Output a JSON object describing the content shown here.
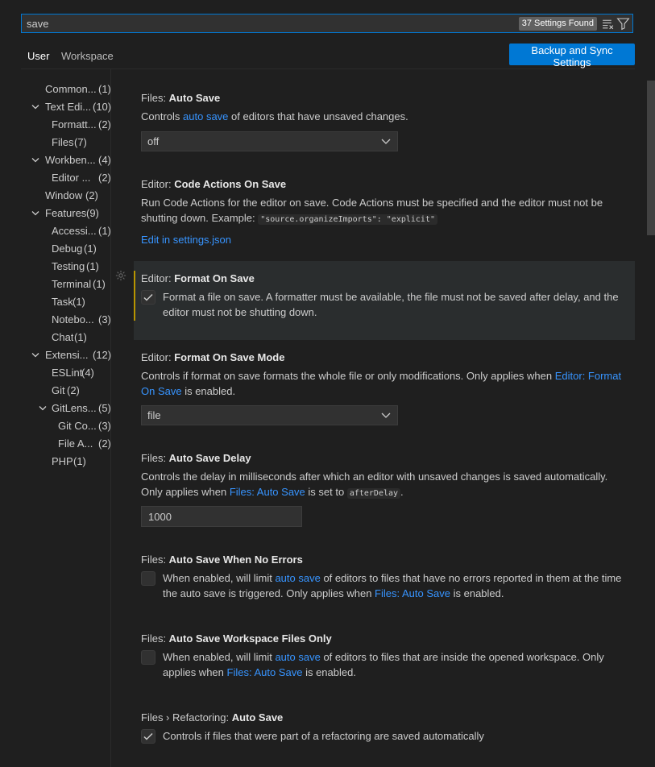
{
  "search": {
    "value": "save",
    "found": "37 Settings Found"
  },
  "tabs": {
    "user": "User",
    "workspace": "Workspace"
  },
  "sync_button": "Backup and Sync Settings",
  "toc": [
    {
      "label": "Common...",
      "count": "(1)"
    },
    {
      "label": "Text Edi...",
      "count": "(10)"
    },
    {
      "label": "Formatt...",
      "count": "(2)"
    },
    {
      "label": "Files",
      "count": "(7)"
    },
    {
      "label": "Workben...",
      "count": "(4)"
    },
    {
      "label": "Editor ...",
      "count": "(2)"
    },
    {
      "label": "Window",
      "count": "(2)"
    },
    {
      "label": "Features",
      "count": "(9)"
    },
    {
      "label": "Accessi...",
      "count": "(1)"
    },
    {
      "label": "Debug",
      "count": "(1)"
    },
    {
      "label": "Testing",
      "count": "(1)"
    },
    {
      "label": "Terminal",
      "count": "(1)"
    },
    {
      "label": "Task",
      "count": "(1)"
    },
    {
      "label": "Notebo...",
      "count": "(3)"
    },
    {
      "label": "Chat",
      "count": "(1)"
    },
    {
      "label": "Extensi...",
      "count": "(12)"
    },
    {
      "label": "ESLint",
      "count": "(4)"
    },
    {
      "label": "Git",
      "count": "(2)"
    },
    {
      "label": "GitLens...",
      "count": "(5)"
    },
    {
      "label": "Git Co...",
      "count": "(3)"
    },
    {
      "label": "File A...",
      "count": "(2)"
    },
    {
      "label": "PHP",
      "count": "(1)"
    }
  ],
  "settings": {
    "auto_save": {
      "category": "Files: ",
      "name": "Auto Save",
      "desc_pre": "Controls ",
      "desc_link": "auto save",
      "desc_post": " of editors that have unsaved changes.",
      "value": "off"
    },
    "code_actions": {
      "category": "Editor: ",
      "name": "Code Actions On Save",
      "desc": "Run Code Actions for the editor on save. Code Actions must be specified and the editor must not be shutting down. Example: ",
      "code": "\"source.organizeImports\": \"explicit\"",
      "link": "Edit in settings.json"
    },
    "format_on_save": {
      "category": "Editor: ",
      "name": "Format On Save",
      "desc": "Format a file on save. A formatter must be available, the file must not be saved after delay, and the editor must not be shutting down.",
      "checked": true
    },
    "format_on_save_mode": {
      "category": "Editor: ",
      "name": "Format On Save Mode",
      "desc_pre": "Controls if format on save formats the whole file or only modifications. Only applies when ",
      "desc_link": "Editor: Format On Save",
      "desc_post": " is enabled.",
      "value": "file"
    },
    "auto_save_delay": {
      "category": "Files: ",
      "name": "Auto Save Delay",
      "desc_pre": "Controls the delay in milliseconds after which an editor with unsaved changes is saved automatically. Only applies when ",
      "desc_link": "Files: Auto Save",
      "desc_mid": " is set to ",
      "code": "afterDelay",
      "desc_post": ".",
      "value": "1000"
    },
    "auto_save_no_errors": {
      "category": "Files: ",
      "name": "Auto Save When No Errors",
      "desc_pre": "When enabled, will limit ",
      "desc_link": "auto save",
      "desc_mid": " of editors to files that have no errors reported in them at the time the auto save is triggered. Only applies when ",
      "desc_link2": "Files: Auto Save",
      "desc_post": " is enabled.",
      "checked": false
    },
    "auto_save_workspace": {
      "category": "Files: ",
      "name": "Auto Save Workspace Files Only",
      "desc_pre": "When enabled, will limit ",
      "desc_link": "auto save",
      "desc_mid": " of editors to files that are inside the opened workspace. Only applies when ",
      "desc_link2": "Files: Auto Save",
      "desc_post": " is enabled.",
      "checked": false
    },
    "refactoring_auto_save": {
      "category": "Files › Refactoring: ",
      "name": "Auto Save",
      "desc": "Controls if files that were part of a refactoring are saved automatically",
      "checked": true
    }
  }
}
